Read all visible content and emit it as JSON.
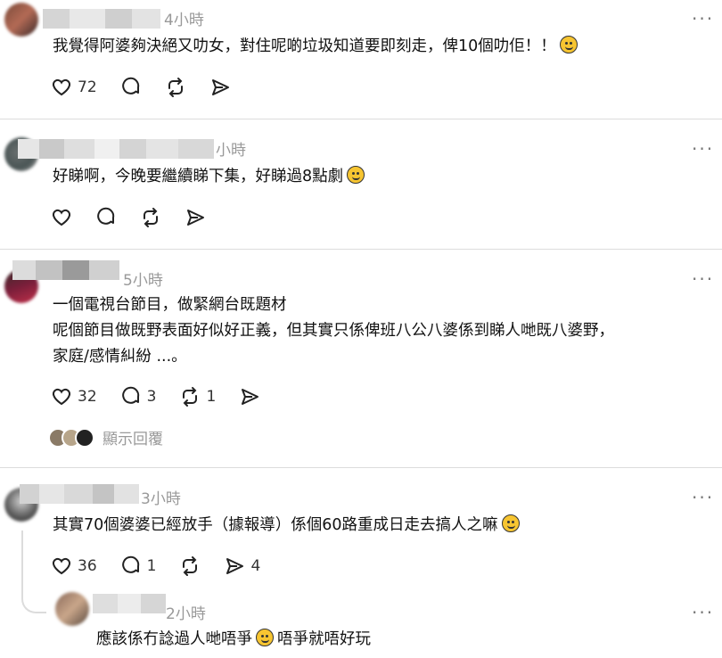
{
  "more_label": "···",
  "posts": [
    {
      "time": "4小時",
      "text": "我覺得阿婆夠決絕又叻女，對住呢啲垃圾知道要即刻走，俾10個叻佢！！",
      "emoji": "smile-emoji",
      "likes": "72",
      "comments": "",
      "reposts": "",
      "shares": ""
    },
    {
      "time": "小時",
      "text": "好睇啊，今晚要繼續睇下集，好睇過8點劇",
      "emoji": "laugh-emoji",
      "likes": "",
      "comments": "",
      "reposts": "",
      "shares": ""
    },
    {
      "username": "anfdl.",
      "time": "5小時",
      "text_lines": [
        "一個電視台節目，做緊網台既題材",
        "呢個節目做既野表面好似好正義，但其實只係俾班八公八婆係到睇人哋既八婆野，",
        "家庭/感情糾紛 ...。"
      ],
      "likes": "32",
      "comments": "3",
      "reposts": "1",
      "shares": "",
      "replies_label": "顯示回覆"
    },
    {
      "time": "3小時",
      "text": "其實70個婆婆已經放手（據報導）係個60路重成日走去搞人之嘛",
      "emoji": "thinking-emoji",
      "likes": "36",
      "comments": "1",
      "reposts": "",
      "shares": "4"
    },
    {
      "time": "2小時",
      "text_a": "應該係冇諗過人哋唔爭",
      "text_b": "唔爭就唔好玩",
      "emoji": "grin-emoji"
    }
  ]
}
